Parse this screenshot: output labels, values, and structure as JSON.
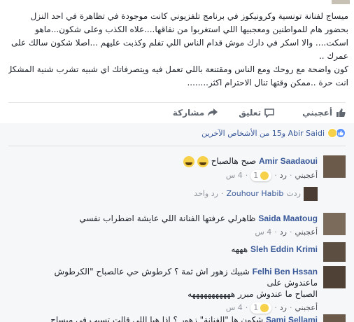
{
  "post": {
    "lines": [
      "ميساج لفنانة تونسية وكرونيكوز في برنامج تلفزيوني كانت موجودة في تظاهرة في احد النزل",
      "بحضور هام للمواطنين ومعجبيها اللي استغربوا من نفاقها....علاه الكذب وعلى شكون...ماهو",
      "اسكت.... والا اسكر في دارك موش قدام الناس اللي تفلم وكذبت عليهم ...اصلا شكون سالك على",
      "عمرك ..",
      "كون واضحة مع روحك ومع الناس ومقتنعة باللي تعمل فيه ويتصرفاتك اي شبيه تشرب شنية المشكل",
      "انت حرة ..ممكن وقتها تنال الاحترام اكثر........"
    ]
  },
  "actions": {
    "like_label": "أعجبني",
    "comment_label": "تعليق",
    "share_label": "مشاركة"
  },
  "reactions": {
    "summary": "Abir Saidi و15 من الأشخاص الآخرين"
  },
  "comments": [
    {
      "author": "Amir Saadaoui",
      "text": "صبح هالصباح",
      "like": "أعجبني",
      "reply": "رد",
      "count": "1",
      "time": "4 س",
      "replies_line": {
        "author": "Zouhour Habib",
        "prefix": "ردت",
        "count_text": "رد واحد"
      }
    },
    {
      "author": "Saida Maatoug",
      "text": "ظاهرلي عرفتها الفنانة اللي عايشة اضطراب نفسي",
      "like": "أعجبني",
      "reply": "رد",
      "time": "4 س"
    },
    {
      "author": "Sleh Eddin Krimi",
      "text": "هههه"
    },
    {
      "author": "Felhi Ben Hssan",
      "text": "شبيك زهور اش ثمة ؟ كرطوش حي عالصباح \"الكرطوش ماعندوش على",
      "text2": "الصباح ما عندوش مبرر هههههههههههه",
      "like": "أعجبني",
      "reply": "رد",
      "count": "1",
      "time": "4 س"
    },
    {
      "author": "Sami Sellami",
      "text": "شكون ها \"الفنانة\" زهور ؟ اذا هيا اللي قالت تسيب في ميساج prive"
    }
  ]
}
